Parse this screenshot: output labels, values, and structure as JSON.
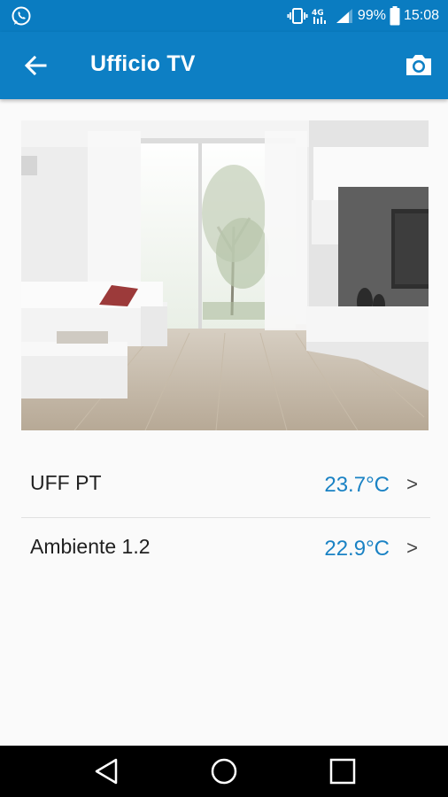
{
  "status_bar": {
    "battery": "99%",
    "time": "15:08",
    "icons": [
      "whatsapp-icon",
      "vibrate-icon",
      "hd-signal-icon",
      "signal-icon",
      "battery-icon"
    ]
  },
  "app_bar": {
    "title": "Ufficio TV",
    "back_icon": "arrow-left-icon",
    "action_icon": "camera-icon"
  },
  "room_photo": {
    "icon": "room-photo"
  },
  "sensors": [
    {
      "name": "UFF PT",
      "temperature": "23.7°C",
      "chevron": ">"
    },
    {
      "name": "Ambiente 1.2",
      "temperature": "22.9°C",
      "chevron": ">"
    }
  ],
  "colors": {
    "status_bar": "#0a7cc1",
    "app_bar": "#0d7fc4",
    "temperature": "#1a82c4",
    "background": "#fafafa"
  },
  "nav_bar": {
    "icons": [
      "back-triangle-icon",
      "home-circle-icon",
      "recents-square-icon"
    ]
  }
}
